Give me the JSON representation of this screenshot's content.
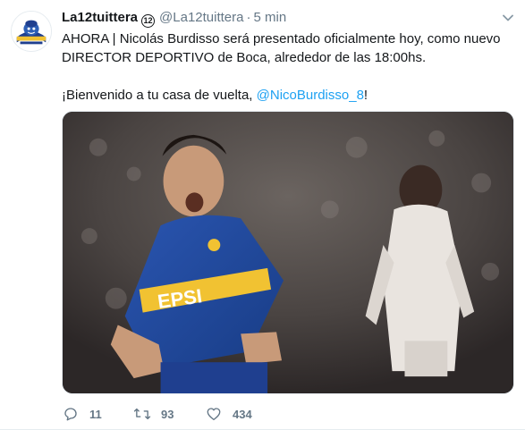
{
  "tweet": {
    "author_name": "La12tuittera",
    "badge_text": "12",
    "author_handle": "@La12tuittera",
    "separator": "·",
    "timestamp": "5 min",
    "text_line1": "AHORA | Nicolás Burdisso será presentado oficialmente hoy, como nuevo DIRECTOR DEPORTIVO de Boca, alrededor de las 18:00hs.",
    "text_line2_prefix": "¡Bienvenido a tu casa de vuelta, ",
    "mention": "@NicoBurdisso_8",
    "text_line2_suffix": "!",
    "jersey_text": "EPSI",
    "counts": {
      "replies": "11",
      "retweets": "93",
      "likes": "434"
    }
  },
  "colors": {
    "link": "#1da1f2",
    "muted": "#657786",
    "text": "#14171a",
    "boca_blue": "#1f3f8f",
    "boca_gold": "#f1c232"
  },
  "icons": {
    "avatar": "boca-mascot-logo",
    "caret": "chevron-down-icon",
    "reply": "reply-icon",
    "retweet": "retweet-icon",
    "like": "heart-icon"
  }
}
